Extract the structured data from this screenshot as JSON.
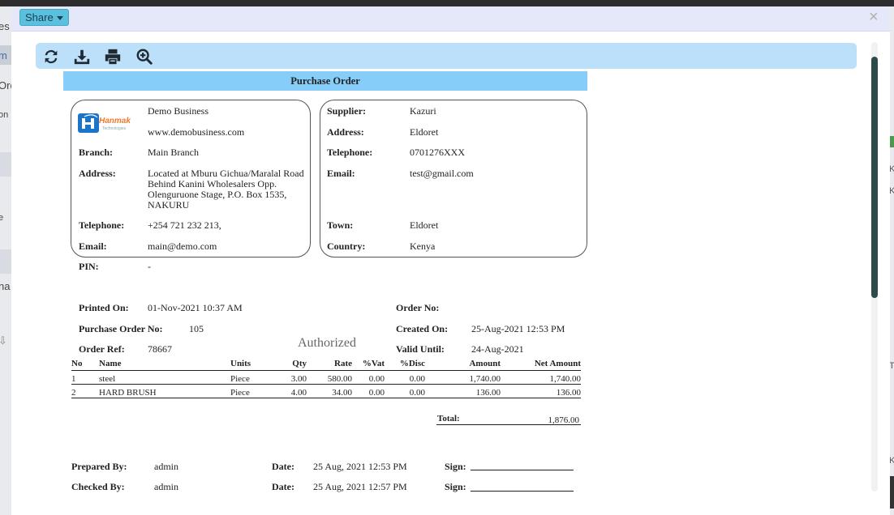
{
  "background": {
    "left_fragments": [
      "es",
      "m",
      "Ord",
      "on",
      "e",
      "na",
      "⇩"
    ],
    "right_fragments": [
      "K",
      "K",
      "T",
      "K",
      "x"
    ]
  },
  "modal": {
    "share_label": "Share",
    "close_symbol": "×"
  },
  "toolbar": {
    "icons": [
      "refresh-icon",
      "download-icon",
      "print-icon",
      "zoom-in-icon"
    ]
  },
  "document": {
    "title": "Purchase Order",
    "authorized_stamp": "Authorized",
    "business": {
      "logo_text": "Hanmak",
      "logo_sub": "Technologies",
      "name": "Demo Business",
      "website": "www.demobusiness.com",
      "branch_label": "Branch:",
      "branch": "Main Branch",
      "address_label": "Address:",
      "address": "Located at Mburu Gichua/Maralal Road Behind Kanini Wholesalers  Opp. Olenguruone Stage, P.O. Box 1535, NAKURU",
      "telephone_label": "Telephone:",
      "telephone": "+254 721 232 213,",
      "email_label": "Email:",
      "email": "main@demo.com",
      "pin_label": "PIN:",
      "pin": "-"
    },
    "supplier": {
      "supplier_label": "Supplier:",
      "supplier": "Kazuri",
      "address_label": "Address:",
      "address": "Eldoret",
      "telephone_label": "Telephone:",
      "telephone": "0701276XXX",
      "email_label": "Email:",
      "email": "test@gmail.com",
      "town_label": "Town:",
      "town": "Eldoret",
      "country_label": "Country:",
      "country": "Kenya"
    },
    "meta": {
      "printed_on_label": "Printed On:",
      "printed_on": "01-Nov-2021 10:37 AM",
      "po_no_label": "Purchase Order No:",
      "po_no": "105",
      "order_ref_label": "Order Ref:",
      "order_ref": "78667",
      "order_no_label": "Order No:",
      "order_no": "",
      "created_on_label": "Created On:",
      "created_on": "25-Aug-2021 12:53 PM",
      "valid_until_label": "Valid Until:",
      "valid_until": "24-Aug-2021"
    },
    "table": {
      "headers": [
        "No",
        "Name",
        "Units",
        "Qty",
        "Rate",
        "%Vat",
        "%Disc",
        "Amount",
        "Net Amount"
      ],
      "rows": [
        [
          "1",
          "steel",
          "Piece",
          "3.00",
          "580.00",
          "0.00",
          "0.00",
          "1,740.00",
          "1,740.00"
        ],
        [
          "2",
          "HARD BRUSH",
          "Piece",
          "4.00",
          "34.00",
          "0.00",
          "0.00",
          "136.00",
          "136.00"
        ]
      ],
      "total_label": "Total:",
      "total": "1,876.00"
    },
    "footer": {
      "prepared_by_label": "Prepared By:",
      "prepared_by": "admin",
      "checked_by_label": "Checked By:",
      "checked_by": "admin",
      "date_label": "Date:",
      "prepared_date": "25 Aug, 2021 12:53 PM",
      "checked_date": "25 Aug, 2021 12:57 PM",
      "sign_label": "Sign:"
    }
  }
}
